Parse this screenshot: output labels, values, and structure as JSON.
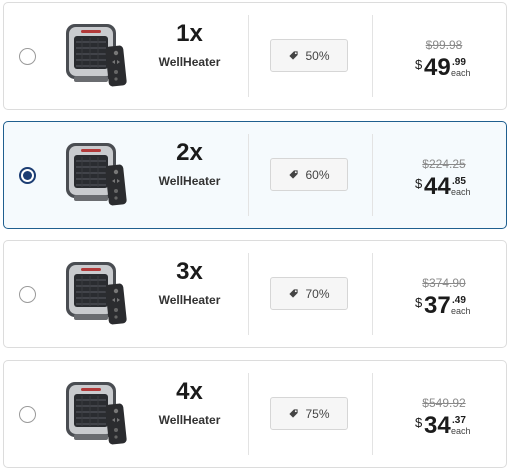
{
  "offers": [
    {
      "quantity": "1x",
      "name": "WellHeater",
      "discount": "50%",
      "old_price": "$99.98",
      "currency": "$",
      "price_int": "49",
      "price_cents": ".99",
      "each": "each",
      "selected": false
    },
    {
      "quantity": "2x",
      "name": "WellHeater",
      "discount": "60%",
      "old_price": "$224.25",
      "currency": "$",
      "price_int": "44",
      "price_cents": ".85",
      "each": "each",
      "selected": true
    },
    {
      "quantity": "3x",
      "name": "WellHeater",
      "discount": "70%",
      "old_price": "$374.90",
      "currency": "$",
      "price_int": "37",
      "price_cents": ".49",
      "each": "each",
      "selected": false
    },
    {
      "quantity": "4x",
      "name": "WellHeater",
      "discount": "75%",
      "old_price": "$549.92",
      "currency": "$",
      "price_int": "34",
      "price_cents": ".37",
      "each": "each",
      "selected": false
    }
  ],
  "colors": {
    "selected_border": "#1f5f8f",
    "selected_bg": "#f5fafd",
    "radio_checked": "#1c3d73"
  },
  "icons": {
    "product": "heater-with-remote-image",
    "discount": "tag-icon"
  }
}
